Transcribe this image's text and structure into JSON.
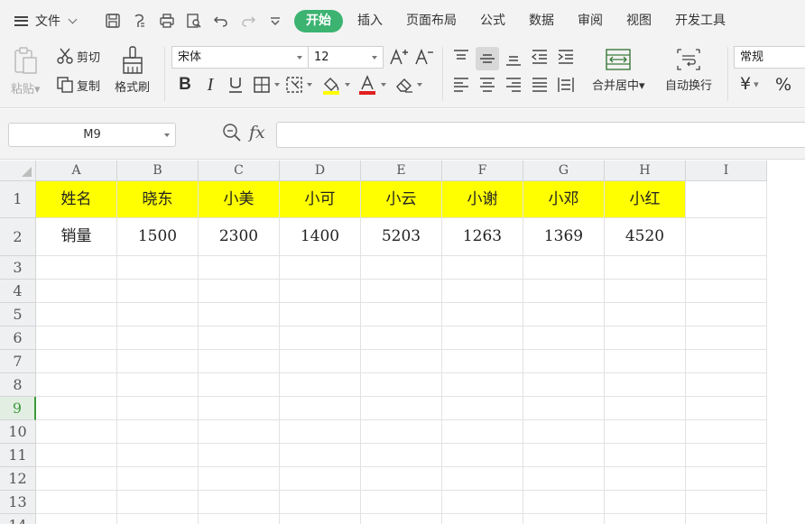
{
  "menu": {
    "file_label": "文件",
    "tabs": [
      {
        "label": "开始",
        "active": true
      },
      {
        "label": "插入",
        "active": false
      },
      {
        "label": "页面布局",
        "active": false
      },
      {
        "label": "公式",
        "active": false
      },
      {
        "label": "数据",
        "active": false
      },
      {
        "label": "审阅",
        "active": false
      },
      {
        "label": "视图",
        "active": false
      },
      {
        "label": "开发工具",
        "active": false
      }
    ]
  },
  "ribbon": {
    "paste_label": "粘贴",
    "cut_label": "剪切",
    "copy_label": "复制",
    "format_painter_label": "格式刷",
    "font_name": "宋体",
    "font_size": "12",
    "merge_center_label": "合并居中",
    "wrap_text_label": "自动换行",
    "number_format": "常规",
    "currency_symbol": "¥",
    "percent_symbol": "%",
    "font_color": "#e02020",
    "fill_color": "#ffff00"
  },
  "formula_bar": {
    "name_box": "M9",
    "fx_label": "fx",
    "formula": ""
  },
  "sheet": {
    "columns": [
      "A",
      "B",
      "C",
      "D",
      "E",
      "F",
      "G",
      "H",
      "I"
    ],
    "rows": [
      "1",
      "2",
      "3",
      "4",
      "5",
      "6",
      "7",
      "8",
      "9",
      "10",
      "11",
      "12",
      "13",
      "14"
    ],
    "active_row": "9",
    "header_fill": "#ffff00",
    "data": [
      [
        "姓名",
        "晓东",
        "小美",
        "小可",
        "小云",
        "小谢",
        "小邓",
        "小红"
      ],
      [
        "销量",
        "1500",
        "2300",
        "1400",
        "5203",
        "1263",
        "1369",
        "4520"
      ]
    ]
  }
}
